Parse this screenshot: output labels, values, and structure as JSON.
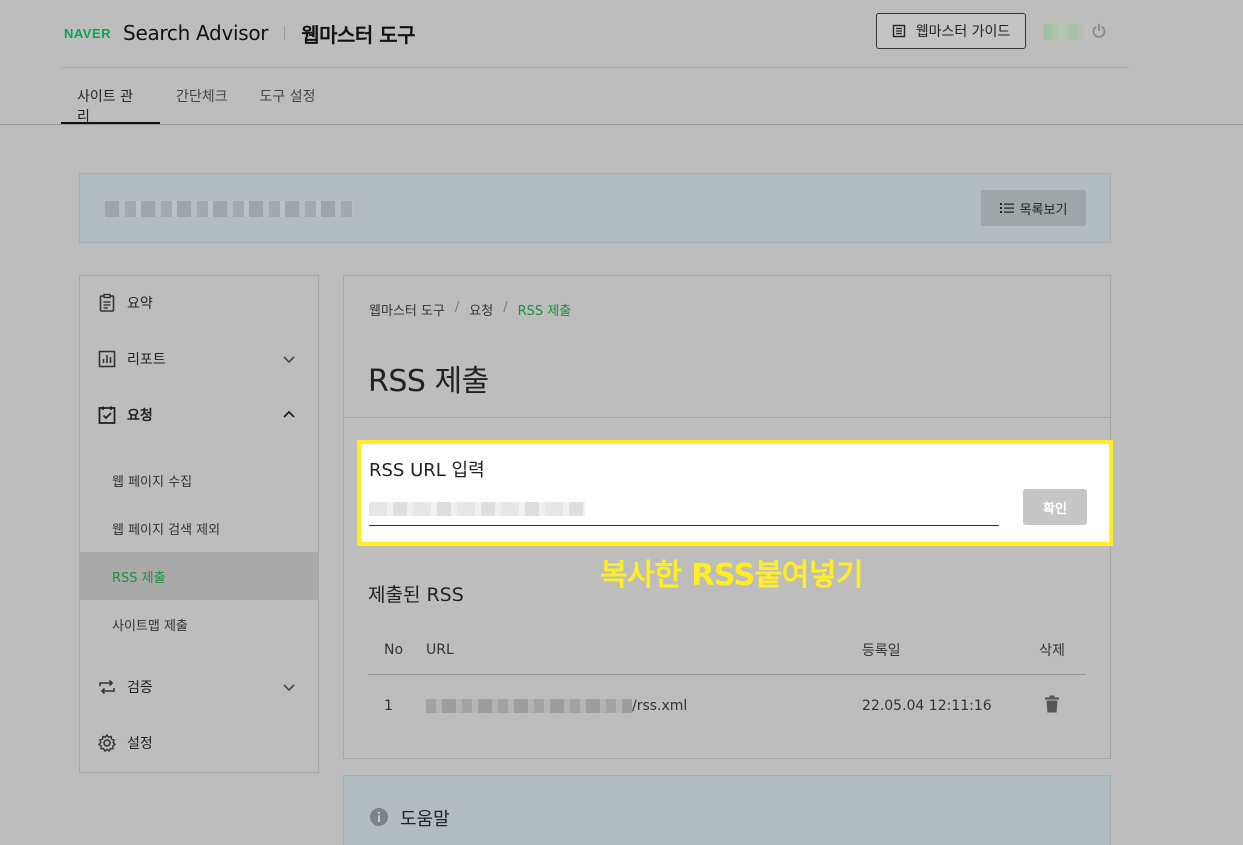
{
  "header": {
    "logo": "NAVER",
    "product": "Search Advisor",
    "tool_title": "웹마스터 도구",
    "guide_button": "웹마스터 가이드"
  },
  "nav": {
    "tabs": [
      {
        "label": "사이트 관리",
        "active": true
      },
      {
        "label": "간단체크",
        "active": false
      },
      {
        "label": "도구 설정",
        "active": false
      }
    ]
  },
  "site_bar": {
    "list_button": "목록보기"
  },
  "sidebar": {
    "items": [
      {
        "label": "요약",
        "icon": "clipboard-icon"
      },
      {
        "label": "리포트",
        "icon": "bar-chart-icon"
      },
      {
        "label": "요청",
        "icon": "checklist-icon"
      },
      {
        "label": "검증",
        "icon": "repeat-icon"
      },
      {
        "label": "설정",
        "icon": "gear-icon"
      }
    ],
    "submenu": [
      {
        "label": "웹 페이지 수집"
      },
      {
        "label": "웹 페이지 검색 제외"
      },
      {
        "label": "RSS 제출",
        "active": true
      },
      {
        "label": "사이트맵 제출"
      }
    ]
  },
  "main": {
    "breadcrumb": [
      "웹마스터 도구",
      "요청",
      "RSS 제출"
    ],
    "title": "RSS 제출",
    "input": {
      "label": "RSS URL 입력",
      "confirm_button": "확인"
    },
    "annotation": "복사한 RSS붙여넣기",
    "submitted_title": "제출된 RSS",
    "table": {
      "headers": [
        "No",
        "URL",
        "등록일",
        "삭제"
      ],
      "rows": [
        {
          "no": "1",
          "url_suffix": "/rss.xml",
          "date": "22.05.04 12:11:16"
        }
      ]
    }
  },
  "help": {
    "label": "도움말"
  },
  "colors": {
    "accent_green": "#1a8f3c",
    "highlight_yellow": "#ffee22"
  }
}
